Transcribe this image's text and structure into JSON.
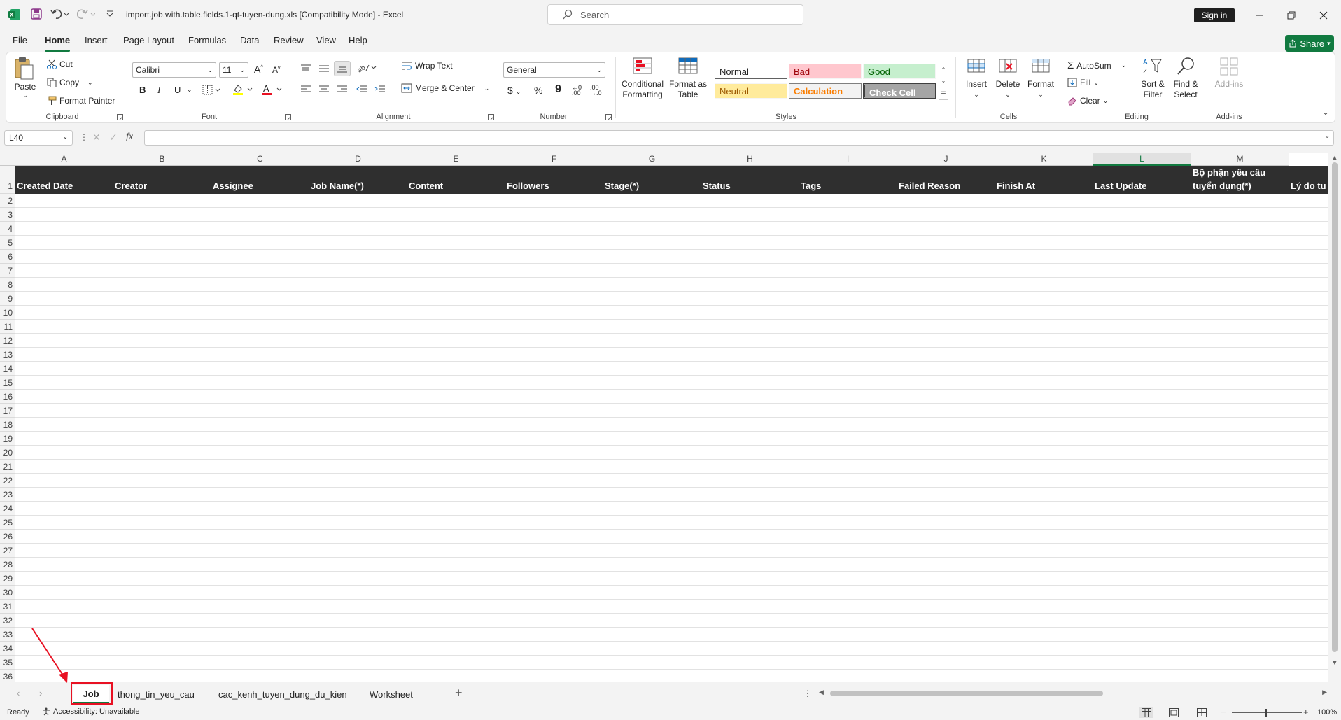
{
  "app": {
    "title": "import.job.with.table.fields.1-qt-tuyen-dung.xls  [Compatibility Mode]  -  Excel",
    "search_placeholder": "Search",
    "sign_in": "Sign in",
    "share": "Share"
  },
  "menu": [
    "File",
    "Home",
    "Insert",
    "Page Layout",
    "Formulas",
    "Data",
    "Review",
    "View",
    "Help"
  ],
  "ribbon": {
    "clipboard": {
      "paste": "Paste",
      "cut": "Cut",
      "copy": "Copy",
      "format_painter": "Format Painter",
      "label": "Clipboard"
    },
    "font": {
      "name": "Calibri",
      "size": "11",
      "label": "Font"
    },
    "alignment": {
      "wrap_text": "Wrap Text",
      "merge_center": "Merge & Center",
      "label": "Alignment"
    },
    "number": {
      "format": "General",
      "label": "Number"
    },
    "styles": {
      "conditional_formatting_1": "Conditional",
      "conditional_formatting_2": "Formatting",
      "format_as_table_1": "Format as",
      "format_as_table_2": "Table",
      "normal": "Normal",
      "bad": "Bad",
      "good": "Good",
      "neutral": "Neutral",
      "calculation": "Calculation",
      "check_cell": "Check Cell",
      "label": "Styles"
    },
    "cells": {
      "insert": "Insert",
      "delete": "Delete",
      "format": "Format",
      "label": "Cells"
    },
    "editing": {
      "autosum": "AutoSum",
      "fill": "Fill",
      "clear": "Clear",
      "sort_filter_1": "Sort &",
      "sort_filter_2": "Filter",
      "find_select_1": "Find &",
      "find_select_2": "Select",
      "label": "Editing"
    },
    "addins": {
      "addins": "Add-ins",
      "label": "Add-ins"
    }
  },
  "formula_bar": {
    "name_box": "L40",
    "fx": "fx",
    "formula": ""
  },
  "columns": [
    "A",
    "B",
    "C",
    "D",
    "E",
    "F",
    "G",
    "H",
    "I",
    "J",
    "K",
    "L",
    "M"
  ],
  "header_row": [
    "Created Date",
    "Creator",
    "Assignee",
    "Job Name(*)",
    "Content",
    "Followers",
    "Stage(*)",
    "Status",
    "Tags",
    "Failed Reason",
    "Finish At",
    "Last Update",
    "Bộ phận yêu cầu tuyển dụng(*)",
    "Lý do tu"
  ],
  "rows": [
    "1",
    "2",
    "3",
    "4",
    "5",
    "6",
    "7",
    "8",
    "9",
    "10",
    "11",
    "12",
    "13",
    "14",
    "15",
    "16",
    "17",
    "18",
    "19",
    "20",
    "21",
    "22",
    "23",
    "24",
    "25",
    "26",
    "27",
    "28",
    "29",
    "30",
    "31",
    "32",
    "33",
    "34",
    "35",
    "36"
  ],
  "sheet_tabs": [
    "Job",
    "thong_tin_yeu_cau",
    "cac_kenh_tuyen_dung_du_kien",
    "Worksheet"
  ],
  "active_sheet": "Job",
  "status": {
    "ready": "Ready",
    "accessibility": "Accessibility: Unavailable",
    "zoom": "100%"
  },
  "colors": {
    "excel_green": "#117a40",
    "header_fill": "#2f2f2f",
    "annotation_red": "#e81123"
  }
}
